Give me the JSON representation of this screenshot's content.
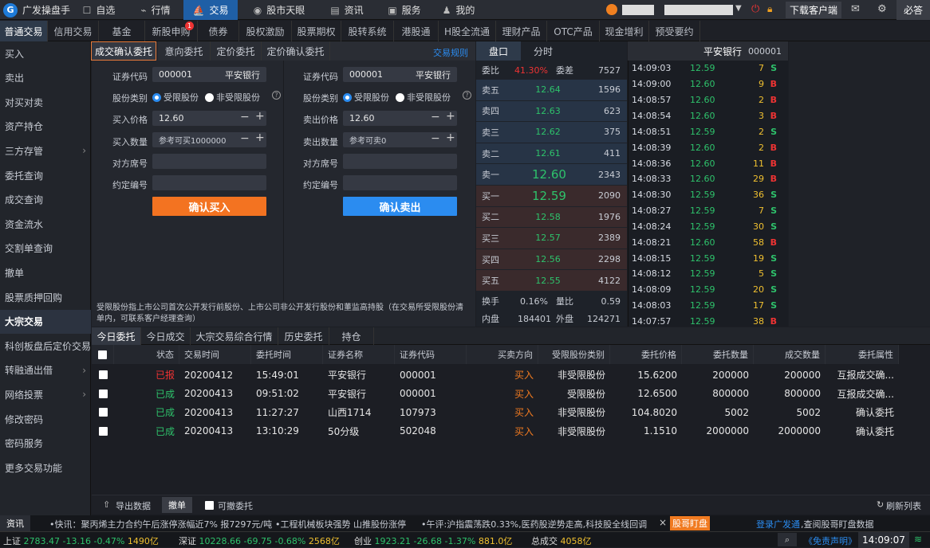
{
  "app": {
    "name": "广发操盘手"
  },
  "nav": [
    {
      "label": "自选",
      "icon": "☐"
    },
    {
      "label": "行情",
      "icon": "⌁"
    },
    {
      "label": "交易",
      "icon": "⛵"
    },
    {
      "label": "股市天眼",
      "icon": "◉"
    },
    {
      "label": "资讯",
      "icon": "▤"
    },
    {
      "label": "服务",
      "icon": "▣"
    },
    {
      "label": "我的",
      "icon": "♟"
    }
  ],
  "topright": {
    "download": "下载客户端",
    "must": "必答",
    "user": "●●●",
    "account": "●●●●●●●●●●●"
  },
  "subtabs": [
    "普通交易",
    "信用交易",
    "基金",
    "新股申购",
    "债券",
    "股权激励",
    "股票期权",
    "股转系统",
    "港股通",
    "H股全流通",
    "理财产品",
    "OTC产品",
    "现金增利",
    "预受要约"
  ],
  "subtab_badge": "1",
  "sidebar": [
    {
      "label": "买入"
    },
    {
      "label": "卖出"
    },
    {
      "label": "对买对卖"
    },
    {
      "label": "资产持仓"
    },
    {
      "label": "三方存管",
      "arrow": "›"
    },
    {
      "label": "委托查询"
    },
    {
      "label": "成交查询"
    },
    {
      "label": "资金流水"
    },
    {
      "label": "交割单查询"
    },
    {
      "label": "撤单"
    },
    {
      "label": "股票质押回购"
    },
    {
      "label": "大宗交易"
    },
    {
      "label": "科创板盘后定价交易"
    },
    {
      "label": "转融通出借",
      "arrow": "›"
    },
    {
      "label": "网络投票",
      "arrow": "›"
    },
    {
      "label": "修改密码"
    },
    {
      "label": "密码服务"
    },
    {
      "label": "更多交易功能"
    }
  ],
  "formtabs": [
    "成交确认委托",
    "意向委托",
    "定价委托",
    "定价确认委托"
  ],
  "trade_rules": "交易规则",
  "buy": {
    "code_label": "证券代码",
    "code": "000001",
    "name": "平安银行",
    "type_label": "股份类别",
    "opt1": "受限股份",
    "opt2": "非受限股份",
    "price_label": "买入价格",
    "price": "12.60",
    "qty_label": "买入数量",
    "qty_ph": "参考可买1000000",
    "seat_label": "对方席号",
    "contract_label": "约定编号",
    "submit": "确认买入"
  },
  "sell": {
    "code_label": "证券代码",
    "code": "000001",
    "name": "平安银行",
    "type_label": "股份类别",
    "opt1": "受限股份",
    "opt2": "非受限股份",
    "price_label": "卖出价格",
    "price": "12.60",
    "qty_label": "卖出数量",
    "qty_ph": "参考可卖0",
    "seat_label": "对方席号",
    "contract_label": "约定编号",
    "submit": "确认卖出"
  },
  "note": "受限股份指上市公司首次公开发行前股份、上市公司非公开发行股份和董监高持股（在交易所受限股份清单内，可联系客户经理查询）",
  "quote": {
    "tab1": "盘口",
    "tab2": "分时",
    "ratio_label": "委比",
    "ratio": "41.30%",
    "diff_label": "委差",
    "diff": "7527",
    "asks": [
      {
        "n": "卖五",
        "p": "12.64",
        "v": "1596"
      },
      {
        "n": "卖四",
        "p": "12.63",
        "v": "623"
      },
      {
        "n": "卖三",
        "p": "12.62",
        "v": "375"
      },
      {
        "n": "卖二",
        "p": "12.61",
        "v": "411"
      },
      {
        "n": "卖一",
        "p": "12.60",
        "v": "2343"
      }
    ],
    "bids": [
      {
        "n": "买一",
        "p": "12.59",
        "v": "2090"
      },
      {
        "n": "买二",
        "p": "12.58",
        "v": "1976"
      },
      {
        "n": "买三",
        "p": "12.57",
        "v": "2389"
      },
      {
        "n": "买四",
        "p": "12.56",
        "v": "2298"
      },
      {
        "n": "买五",
        "p": "12.55",
        "v": "4122"
      }
    ],
    "turnover_label": "换手",
    "turnover": "0.16%",
    "vr_label": "量比",
    "vr": "0.59",
    "inner_label": "内盘",
    "inner": "184401",
    "outer_label": "外盘",
    "outer": "124271"
  },
  "ticks_title": "平安银行",
  "ticks_code": "000001",
  "ticks": [
    [
      "14:09:03",
      "12.59",
      "7",
      "S"
    ],
    [
      "14:09:00",
      "12.60",
      "9",
      "B"
    ],
    [
      "14:08:57",
      "12.60",
      "2",
      "B"
    ],
    [
      "14:08:54",
      "12.60",
      "3",
      "B"
    ],
    [
      "14:08:51",
      "12.59",
      "2",
      "S"
    ],
    [
      "14:08:39",
      "12.60",
      "2",
      "B"
    ],
    [
      "14:08:36",
      "12.60",
      "11",
      "B"
    ],
    [
      "14:08:33",
      "12.60",
      "29",
      "B"
    ],
    [
      "14:08:30",
      "12.59",
      "36",
      "S"
    ],
    [
      "14:08:27",
      "12.59",
      "7",
      "S"
    ],
    [
      "14:08:24",
      "12.59",
      "30",
      "S"
    ],
    [
      "14:08:21",
      "12.60",
      "58",
      "B"
    ],
    [
      "14:08:15",
      "12.59",
      "19",
      "S"
    ],
    [
      "14:08:12",
      "12.59",
      "5",
      "S"
    ],
    [
      "14:08:09",
      "12.59",
      "20",
      "S"
    ],
    [
      "14:08:03",
      "12.59",
      "17",
      "S"
    ],
    [
      "14:07:57",
      "12.59",
      "38",
      "B"
    ]
  ],
  "btabs": [
    "今日委托",
    "今日成交",
    "大宗交易综合行情",
    "历史委托",
    "持仓"
  ],
  "table": {
    "headers": [
      "状态",
      "交易时间",
      "委托时间",
      "证券名称",
      "证券代码",
      "买卖方向",
      "受限股份类别",
      "委托价格",
      "委托数量",
      "成交数量",
      "委托属性"
    ],
    "rows": [
      [
        "已报",
        "20200412",
        "15:49:01",
        "平安银行",
        "000001",
        "买入",
        "非受限股份",
        "15.6200",
        "200000",
        "200000",
        "互报成交确..."
      ],
      [
        "已成",
        "20200413",
        "09:51:02",
        "平安银行",
        "000001",
        "买入",
        "受限股份",
        "12.6500",
        "800000",
        "800000",
        "互报成交确..."
      ],
      [
        "已成",
        "20200413",
        "11:27:27",
        "山西1714",
        "107973",
        "买入",
        "非受限股份",
        "104.8020",
        "5002",
        "5002",
        "确认委托"
      ],
      [
        "已成",
        "20200413",
        "13:10:29",
        "50分级",
        "502048",
        "买入",
        "非受限股份",
        "1.1510",
        "2000000",
        "2000000",
        "确认委托"
      ]
    ]
  },
  "tfoot": {
    "export": "导出数据",
    "cancel": "撤单",
    "cancelable": "可撤委托",
    "refresh": "刷新列表"
  },
  "ticker": {
    "label": "资讯",
    "items": [
      "•快讯：聚丙烯主力合约午后涨停涨幅近7% 报7297元/吨",
      "•工程机械板块强势 山推股份涨停",
      "•午评:沪指震荡跌0.33%,医药股逆势走高,科技股全线回调"
    ],
    "close": "×",
    "tag": "股哥盯盘",
    "link": "登录广发通",
    "tail": ",查阅股哥盯盘数据"
  },
  "status": {
    "sh_label": "上证",
    "sh": "2783.47",
    "sh_chg": "-13.16",
    "sh_pct": "-0.47%",
    "sh_amt": "1490亿",
    "sz_label": "深证",
    "sz": "10228.66",
    "sz_chg": "-69.75",
    "sz_pct": "-0.68%",
    "sz_amt": "2568亿",
    "cy_label": "创业",
    "cy": "1923.21",
    "cy_chg": "-26.68",
    "cy_pct": "-1.37%",
    "cy_amt": "881.0亿",
    "total_label": "总成交",
    "total": "4058亿",
    "disclaimer": "《免责声明》",
    "time": "14:09:07"
  }
}
